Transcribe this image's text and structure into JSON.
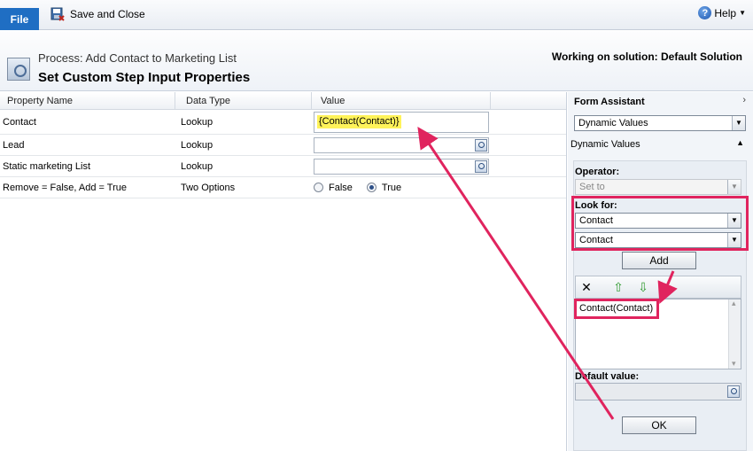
{
  "ribbon": {
    "file_tab": "File",
    "save_close": "Save and Close",
    "help": "Help"
  },
  "header": {
    "process_label": "Process: Add Contact to Marketing List",
    "title": "Set Custom Step Input Properties",
    "solution": "Working on solution: Default Solution"
  },
  "grid": {
    "columns": [
      "Property Name",
      "Data Type",
      "Value"
    ],
    "rows": [
      {
        "name": "Contact",
        "type": "Lookup",
        "value": "{Contact(Contact)}"
      },
      {
        "name": "Lead",
        "type": "Lookup",
        "value": ""
      },
      {
        "name": "Static marketing List",
        "type": "Lookup",
        "value": ""
      },
      {
        "name": "Remove = False, Add = True",
        "type": "Two Options",
        "false_label": "False",
        "true_label": "True",
        "selected": "True"
      }
    ]
  },
  "panel": {
    "title": "Form Assistant",
    "mode_select": "Dynamic Values",
    "section_label": "Dynamic Values",
    "operator_label": "Operator:",
    "operator_value": "Set to",
    "look_for_label": "Look for:",
    "look_for_entity": "Contact",
    "look_for_field": "Contact",
    "add_button": "Add",
    "list_items": [
      "Contact(Contact)"
    ],
    "default_label": "Default value:",
    "ok_button": "OK"
  },
  "colors": {
    "accent": "#1f6ec3",
    "annotation": "#e0245e",
    "highlight": "#fff35a"
  }
}
